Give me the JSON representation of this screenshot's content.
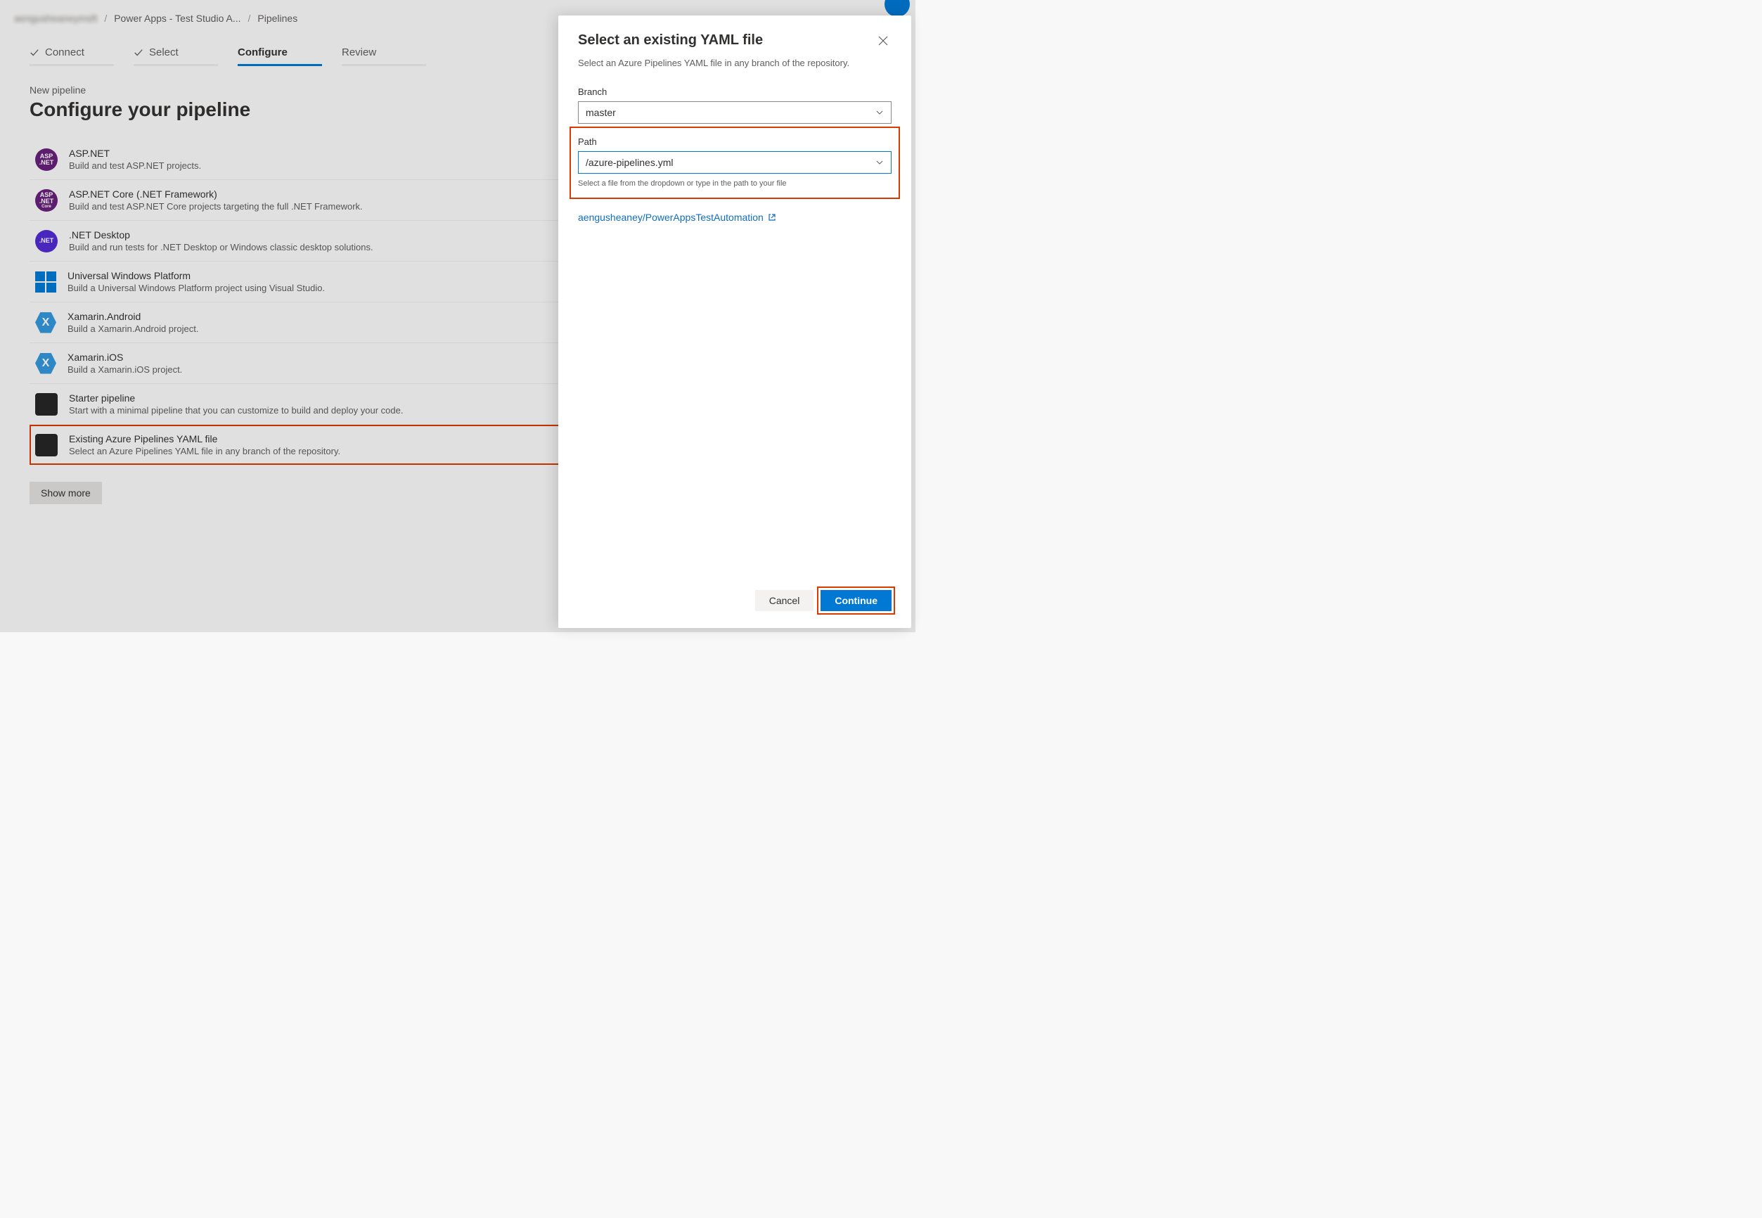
{
  "breadcrumb": {
    "item1": "aengusheaneymsft",
    "item2": "Power Apps - Test Studio A...",
    "item3": "Pipelines"
  },
  "steps": {
    "connect": "Connect",
    "select": "Select",
    "configure": "Configure",
    "review": "Review"
  },
  "page": {
    "subtitle": "New pipeline",
    "title": "Configure your pipeline"
  },
  "templates": [
    {
      "name": "ASP.NET",
      "desc": "Build and test ASP.NET projects.",
      "iconType": "aspnet",
      "iconText": "ASP\n.NET"
    },
    {
      "name": "ASP.NET Core (.NET Framework)",
      "desc": "Build and test ASP.NET Core projects targeting the full .NET Framework.",
      "iconType": "aspnet",
      "iconText": "ASP\n.NET",
      "subText": "Core"
    },
    {
      "name": ".NET Desktop",
      "desc": "Build and run tests for .NET Desktop or Windows classic desktop solutions.",
      "iconType": "netdesktop",
      "iconText": ".NET"
    },
    {
      "name": "Universal Windows Platform",
      "desc": "Build a Universal Windows Platform project using Visual Studio.",
      "iconType": "windows"
    },
    {
      "name": "Xamarin.Android",
      "desc": "Build a Xamarin.Android project.",
      "iconType": "xamarin"
    },
    {
      "name": "Xamarin.iOS",
      "desc": "Build a Xamarin.iOS project.",
      "iconType": "xamarin"
    },
    {
      "name": "Starter pipeline",
      "desc": "Start with a minimal pipeline that you can customize to build and deploy your code.",
      "iconType": "yaml"
    },
    {
      "name": "Existing Azure Pipelines YAML file",
      "desc": "Select an Azure Pipelines YAML file in any branch of the repository.",
      "iconType": "yaml",
      "highlighted": true
    }
  ],
  "showMore": "Show more",
  "panel": {
    "title": "Select an existing YAML file",
    "subtitle": "Select an Azure Pipelines YAML file in any branch of the repository.",
    "branchLabel": "Branch",
    "branchValue": "master",
    "pathLabel": "Path",
    "pathValue": "/azure-pipelines.yml",
    "pathHelp": "Select a file from the dropdown or type in the path to your file",
    "repoLink": "aengusheaney/PowerAppsTestAutomation",
    "cancel": "Cancel",
    "continue": "Continue"
  }
}
